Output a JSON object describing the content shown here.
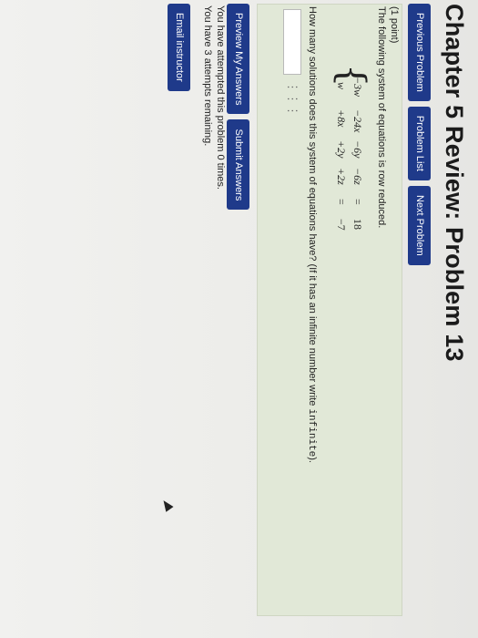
{
  "title": "Chapter 5 Review: Problem 13",
  "nav": {
    "previous": "Previous Problem",
    "list": "Problem List",
    "next": "Next Problem"
  },
  "problem": {
    "points": "(1 point)",
    "intro": "The following system of equations is row reduced.",
    "equations": [
      [
        "−3w",
        "−24x",
        "−6y",
        "−6z",
        "=",
        "18"
      ],
      [
        "w",
        "+8x",
        "+2y",
        "+2z",
        "=",
        "−7"
      ]
    ],
    "question_prefix": "How many solutions does this system of equations have? (If it has an infinite number write ",
    "question_code": "infinite",
    "question_suffix": ").",
    "answer_value": ""
  },
  "actions": {
    "preview": "Preview My Answers",
    "submit": "Submit Answers"
  },
  "status": {
    "attempted": "You have attempted this problem 0 times.",
    "remaining": "You have 3 attempts remaining."
  },
  "email_label": "Email instructor",
  "colors": {
    "button": "#1f3a8a",
    "panel": "#e1e8d7"
  }
}
